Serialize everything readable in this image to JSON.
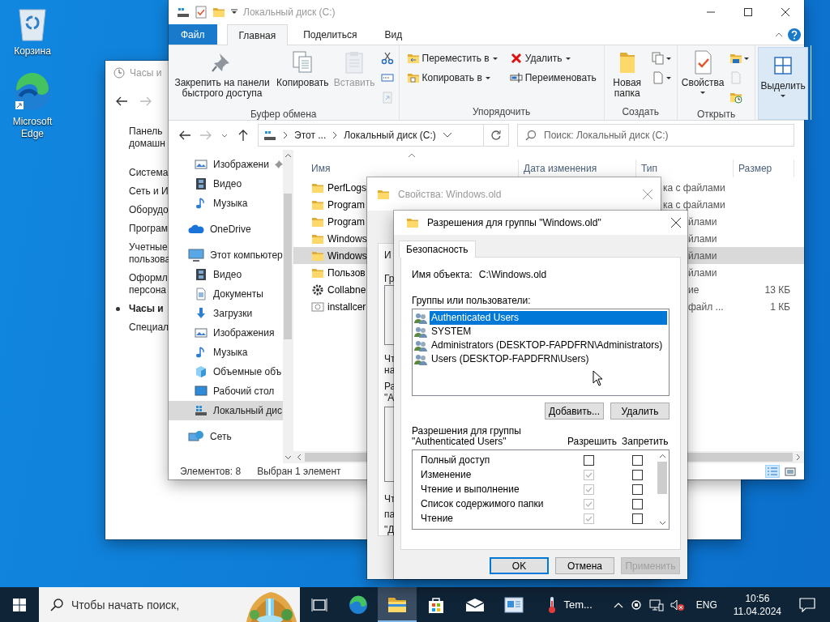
{
  "desktop_icons": [
    {
      "label": "Корзина",
      "kind": "recycle_bin"
    },
    {
      "label": "Microsoft Edge",
      "kind": "edge"
    }
  ],
  "control_panel": {
    "title": "Часы и",
    "links": [
      {
        "lines": [
          "Панель",
          "домашн"
        ],
        "selected": false
      },
      {
        "lines": [
          "Система"
        ],
        "selected": false
      },
      {
        "lines": [
          "Сеть и И"
        ],
        "selected": false
      },
      {
        "lines": [
          "Оборудо"
        ],
        "selected": false
      },
      {
        "lines": [
          "Програм"
        ],
        "selected": false
      },
      {
        "lines": [
          "Учетные",
          "пользова"
        ],
        "selected": false
      },
      {
        "lines": [
          "Оформл",
          "персона"
        ],
        "selected": false
      },
      {
        "lines": [
          "Часы и"
        ],
        "selected": true
      },
      {
        "lines": [
          "Специал"
        ],
        "selected": false
      }
    ]
  },
  "explorer": {
    "title": "Локальный диск (C:)",
    "tabs": [
      {
        "label": "Файл",
        "kind": "file",
        "selected": false
      },
      {
        "label": "Главная",
        "kind": "tab",
        "selected": true
      },
      {
        "label": "Поделиться",
        "kind": "tab",
        "selected": false
      },
      {
        "label": "Вид",
        "kind": "tab",
        "selected": false
      }
    ],
    "ribbon_groups": [
      {
        "label": "Буфер обмена",
        "commands": [
          {
            "kind": "large",
            "label": "Закрепить на панели быстрого доступа",
            "disabled": false,
            "has_menu": false
          },
          {
            "kind": "large",
            "label": "Копировать",
            "disabled": false,
            "has_menu": false
          },
          {
            "kind": "large",
            "label": "Вставить",
            "disabled": true,
            "has_menu": false
          },
          {
            "kind": "icon",
            "disabled": false,
            "has_menu": false
          },
          {
            "kind": "icon",
            "disabled": false,
            "has_menu": false
          },
          {
            "kind": "icon",
            "disabled": true,
            "has_menu": false
          }
        ]
      },
      {
        "label": "Упорядочить",
        "commands": [
          {
            "kind": "small",
            "label": "Переместить в",
            "disabled": false,
            "has_menu": true
          },
          {
            "kind": "small",
            "label": "Копировать в",
            "disabled": false,
            "has_menu": true
          },
          {
            "kind": "small",
            "label": "Удалить",
            "disabled": false,
            "has_menu": true
          },
          {
            "kind": "small",
            "label": "Переименовать",
            "disabled": false,
            "has_menu": false
          }
        ]
      },
      {
        "label": "Создать",
        "commands": [
          {
            "kind": "large",
            "label": "Новая папка",
            "disabled": false,
            "has_menu": false
          },
          {
            "kind": "icon",
            "disabled": false,
            "has_menu": true
          },
          {
            "kind": "icon",
            "disabled": false,
            "has_menu": true
          }
        ]
      },
      {
        "label": "Открыть",
        "commands": [
          {
            "kind": "large",
            "label": "Свойства",
            "disabled": false,
            "has_menu": true
          },
          {
            "kind": "icon",
            "disabled": false,
            "has_menu": true
          },
          {
            "kind": "icon",
            "disabled": true,
            "has_menu": false
          },
          {
            "kind": "icon",
            "disabled": false,
            "has_menu": false
          }
        ]
      },
      {
        "commands": [
          {
            "kind": "large",
            "label": "Выделить",
            "disabled": false,
            "has_menu": true,
            "highlighted": true
          }
        ]
      }
    ],
    "address": {
      "crumbs": [
        "Этот ...",
        "Локальный диск (C:)"
      ],
      "search_placeholder": "Поиск: Локальный диск (C:)"
    },
    "nav_pane": {
      "quick_access": [
        {
          "label": "Изображени",
          "kind": "pictures",
          "pinned": true,
          "selected": false
        },
        {
          "label": "Видео",
          "kind": "videos",
          "pinned": false,
          "selected": false
        },
        {
          "label": "Музыка",
          "kind": "music",
          "pinned": false,
          "selected": false
        }
      ],
      "items": [
        {
          "label": "OneDrive",
          "kind": "onedrive",
          "selected": false
        },
        {
          "label": "Этот компьютер",
          "kind": "pc",
          "selected": false,
          "children": [
            {
              "label": "Видео",
              "kind": "videos",
              "selected": false
            },
            {
              "label": "Документы",
              "kind": "documents",
              "selected": false
            },
            {
              "label": "Загрузки",
              "kind": "downloads",
              "selected": false
            },
            {
              "label": "Изображения",
              "kind": "pictures",
              "selected": false
            },
            {
              "label": "Музыка",
              "kind": "music",
              "selected": false
            },
            {
              "label": "Объемные объ",
              "kind": "objects3d",
              "selected": false
            },
            {
              "label": "Рабочий стол",
              "kind": "desktop",
              "selected": false
            },
            {
              "label": "Локальный дис",
              "kind": "drive",
              "selected": true
            }
          ]
        },
        {
          "label": "Сеть",
          "kind": "network",
          "selected": false
        }
      ]
    },
    "columns": [
      "Имя",
      "Дата изменения",
      "Тип",
      "Размер"
    ],
    "files": [
      {
        "name": "PerfLogs",
        "kind": "folder",
        "type": "ка с файлами",
        "selected": false
      },
      {
        "name": "Program",
        "kind": "folder",
        "type": "ка с файлами",
        "selected": false
      },
      {
        "name": "Program",
        "kind": "folder",
        "type": "йлами",
        "selected": false
      },
      {
        "name": "Windows",
        "kind": "folder",
        "type": "йлами",
        "selected": false
      },
      {
        "name": "Windows",
        "kind": "folder",
        "type": "йлами",
        "selected": true
      },
      {
        "name": "Пользов",
        "kind": "folder",
        "type": "йлами",
        "selected": false
      },
      {
        "name": "Collabne",
        "kind": "app",
        "type": "ие",
        "size": "13 КБ",
        "selected": false
      },
      {
        "name": "installcer",
        "kind": "file",
        "type": "файл ...",
        "size": "1 КБ",
        "selected": false
      }
    ],
    "status": {
      "count": "Элементов: 8",
      "selection": "Выбран 1 элемент"
    },
    "views": [
      {
        "kind": "details",
        "selected": true
      },
      {
        "kind": "tiles",
        "selected": false
      }
    ]
  },
  "properties_window": {
    "title": "Свойства: Windows.old",
    "fragments": [
      {
        "kind": "text",
        "text": "И"
      },
      {
        "kind": "text",
        "text": "Гр"
      },
      {
        "kind": "box"
      },
      {
        "kind": "text",
        "text": "Чт"
      },
      {
        "kind": "text",
        "text": "на"
      },
      {
        "kind": "text",
        "text": "Ра"
      },
      {
        "kind": "text",
        "text": "\"A"
      },
      {
        "kind": "box"
      },
      {
        "kind": "text",
        "text": "Чт"
      },
      {
        "kind": "text",
        "text": "па"
      },
      {
        "kind": "text",
        "text": "\"Д"
      }
    ]
  },
  "permissions_dialog": {
    "title": "Разрешения для группы \"Windows.old\"",
    "tabs": [
      {
        "label": "Безопасность",
        "selected": true
      }
    ],
    "object_label": "Имя объекта:",
    "object_name": "C:\\Windows.old",
    "users_label": "Группы или пользователи:",
    "users": [
      {
        "name": "Authenticated Users",
        "selected": true
      },
      {
        "name": "SYSTEM",
        "selected": false
      },
      {
        "name": "Administrators (DESKTOP-FAPDFRN\\Administrators)",
        "selected": false
      },
      {
        "name": "Users (DESKTOP-FAPDFRN\\Users)",
        "selected": false
      }
    ],
    "list_buttons": [
      "Добавить...",
      "Удалить"
    ],
    "permissions_label": "Разрешения для группы \"Authenticated Users\"",
    "columns": [
      "Разрешить",
      "Запретить"
    ],
    "permissions": [
      {
        "name": "Полный доступ",
        "allow": false,
        "allow_disabled": false,
        "deny": false
      },
      {
        "name": "Изменение",
        "allow": true,
        "allow_disabled": true,
        "deny": false
      },
      {
        "name": "Чтение и выполнение",
        "allow": true,
        "allow_disabled": true,
        "deny": false
      },
      {
        "name": "Список содержимого папки",
        "allow": true,
        "allow_disabled": true,
        "deny": false
      },
      {
        "name": "Чтение",
        "allow": true,
        "allow_disabled": true,
        "deny": false
      }
    ],
    "buttons": [
      {
        "label": "OK",
        "kind": "default",
        "disabled": false
      },
      {
        "label": "Отмена",
        "kind": "normal",
        "disabled": false
      },
      {
        "label": "Применить",
        "kind": "normal",
        "disabled": true
      }
    ]
  },
  "taskbar": {
    "search_placeholder": "Чтобы начать поиск,",
    "apps": [
      {
        "kind": "task_view",
        "active": false
      },
      {
        "kind": "edge",
        "active": false
      },
      {
        "kind": "explorer",
        "active": true
      },
      {
        "kind": "store",
        "active": false
      },
      {
        "kind": "mail",
        "active": false
      },
      {
        "kind": "app",
        "active": false
      }
    ],
    "weather": "Tem...",
    "language": "ENG",
    "time": "10:56",
    "date": "11.04.2024"
  }
}
